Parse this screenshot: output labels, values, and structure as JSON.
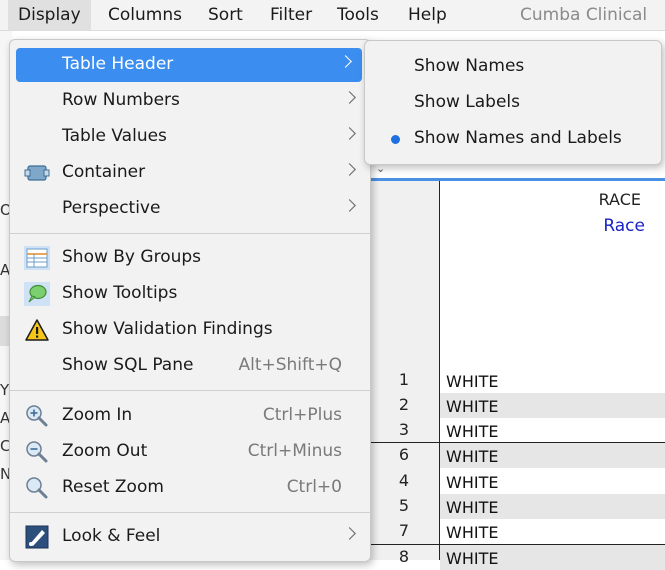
{
  "menubar": {
    "items": [
      "Display",
      "Columns",
      "Sort",
      "Filter",
      "Tools",
      "Help"
    ],
    "title": "Cumba Clinical"
  },
  "display_menu": {
    "items": [
      {
        "label": "Table Header",
        "submenu": true,
        "highlighted": true
      },
      {
        "label": "Row Numbers",
        "submenu": true
      },
      {
        "label": "Table Values",
        "submenu": true
      },
      {
        "label": "Container",
        "submenu": true,
        "icon": "container-icon"
      },
      {
        "label": "Perspective",
        "submenu": true
      },
      {
        "label": "Show By Groups",
        "icon": "groups-icon"
      },
      {
        "label": "Show Tooltips",
        "icon": "tooltip-icon"
      },
      {
        "label": "Show Validation Findings",
        "icon": "warning-icon"
      },
      {
        "label": "Show SQL Pane",
        "shortcut": "Alt+Shift+Q"
      },
      {
        "label": "Zoom In",
        "shortcut": "Ctrl+Plus",
        "icon": "zoom-in-icon"
      },
      {
        "label": "Zoom Out",
        "shortcut": "Ctrl+Minus",
        "icon": "zoom-out-icon"
      },
      {
        "label": "Reset Zoom",
        "shortcut": "Ctrl+0",
        "icon": "reset-zoom-icon"
      },
      {
        "label": "Look & Feel",
        "submenu": true,
        "icon": "look-and-feel-icon"
      }
    ]
  },
  "table_header_submenu": {
    "items": [
      {
        "label": "Show Names",
        "selected": false
      },
      {
        "label": "Show Labels",
        "selected": false
      },
      {
        "label": "Show Names and Labels",
        "selected": true
      }
    ]
  },
  "table": {
    "column_name": "RACE",
    "column_label": "Race",
    "rows": [
      {
        "num": "1",
        "value": "WHITE"
      },
      {
        "num": "2",
        "value": "WHITE"
      },
      {
        "num": "3",
        "value": "WHITE"
      },
      {
        "num": "6",
        "value": "WHITE"
      },
      {
        "num": "4",
        "value": "WHITE"
      },
      {
        "num": "5",
        "value": "WHITE"
      },
      {
        "num": "7",
        "value": "WHITE"
      },
      {
        "num": "8",
        "value": "WHITE"
      }
    ]
  },
  "background_left_chars": [
    "O",
    "A",
    "Y",
    "A",
    "C",
    "N"
  ],
  "colors": {
    "highlight": "#3b8ef0",
    "radio_dot": "#1e6fe0",
    "label_text": "#1a22c8"
  }
}
